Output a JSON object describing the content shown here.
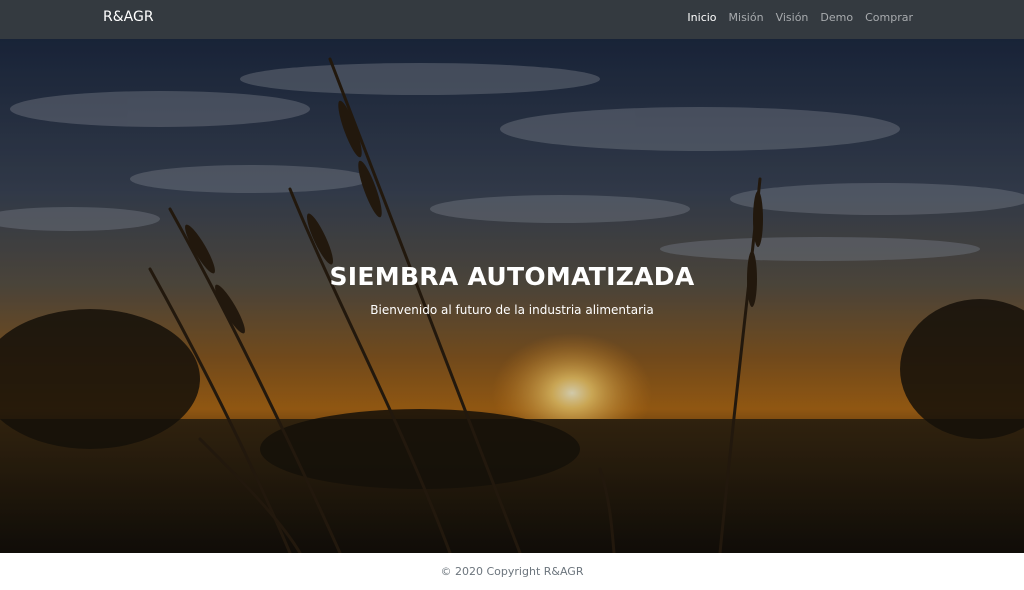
{
  "nav": {
    "brand": "R&AGR",
    "links": [
      {
        "label": "Inicio",
        "active": true
      },
      {
        "label": "Misión",
        "active": false
      },
      {
        "label": "Visión",
        "active": false
      },
      {
        "label": "Demo",
        "active": false
      },
      {
        "label": "Comprar",
        "active": false
      }
    ]
  },
  "hero": {
    "title": "SIEMBRA AUTOMATIZADA",
    "subtitle": "Bienvenido al futuro de la industria alimentaria"
  },
  "footer": {
    "copyright": "© 2020 Copyright R&AGR"
  },
  "colors": {
    "navbar_bg": "#343a40",
    "nav_active": "#ffffff",
    "nav_inactive": "#a8abae",
    "footer_text": "#6c757d"
  }
}
